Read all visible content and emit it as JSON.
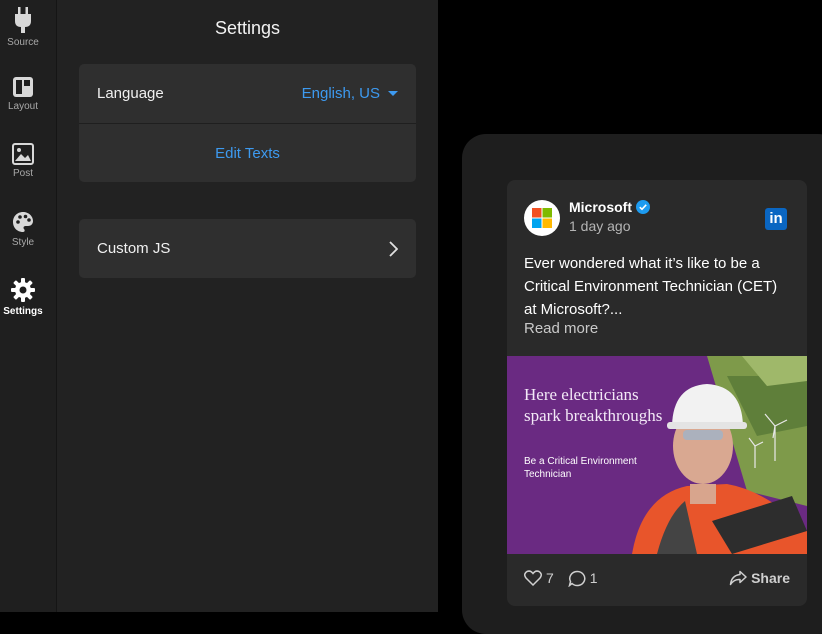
{
  "rail": {
    "items": [
      {
        "label": "Source",
        "icon": "plug-icon"
      },
      {
        "label": "Layout",
        "icon": "layout-icon"
      },
      {
        "label": "Post",
        "icon": "image-icon"
      },
      {
        "label": "Style",
        "icon": "palette-icon"
      },
      {
        "label": "Settings",
        "icon": "gear-icon",
        "active": true
      }
    ]
  },
  "panel": {
    "title": "Settings",
    "language_label": "Language",
    "language_value": "English, US",
    "edit_texts": "Edit Texts",
    "custom_js": "Custom JS"
  },
  "post": {
    "author": "Microsoft",
    "time": "1 day ago",
    "text": "Ever wondered what it’s like to be a Critical Environment Technician (CET) at Microsoft?...",
    "read_more": "Read more",
    "image_headline": "Here electricians spark breakthroughs",
    "image_subline": "Be a Critical Environment Technician",
    "likes": "7",
    "comments": "1",
    "share": "Share"
  },
  "colors": {
    "accent": "#3d9af0",
    "panel_bg": "#222222",
    "card_bg": "#2f2f2f",
    "linkedin": "#0a66c2",
    "image_bg": "#6a2a82"
  }
}
